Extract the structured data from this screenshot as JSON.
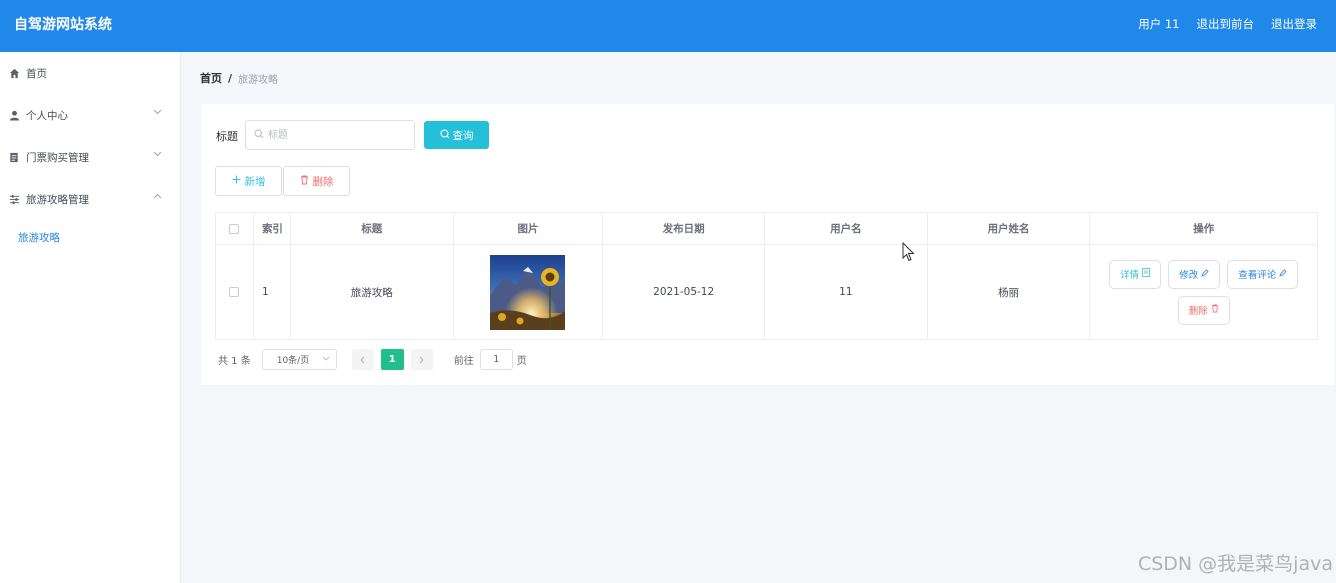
{
  "app": {
    "title": "自驾游网站系统"
  },
  "header": {
    "user_label": "用户 11",
    "front_label": "退出到前台",
    "logout_label": "退出登录"
  },
  "sidebar": {
    "items": [
      {
        "label": "首页",
        "icon": "home-icon"
      },
      {
        "label": "个人中心",
        "icon": "user-icon"
      },
      {
        "label": "门票购买管理",
        "icon": "document-icon"
      },
      {
        "label": "旅游攻略管理",
        "icon": "sliders-icon"
      }
    ],
    "sub_items": [
      {
        "label": "旅游攻略"
      }
    ]
  },
  "breadcrumb": {
    "home": "首页",
    "separator": "/",
    "current": "旅游攻略"
  },
  "search": {
    "label": "标题",
    "placeholder": "标题",
    "value": "",
    "button_label": "查询"
  },
  "toolbar": {
    "add_label": "新增",
    "delete_label": "删除"
  },
  "table": {
    "headers": [
      "索引",
      "标题",
      "图片",
      "发布日期",
      "用户名",
      "用户姓名",
      "操作"
    ],
    "rows": [
      {
        "index": "1",
        "title": "旅游攻略",
        "image": "sunflower-landscape-thumbnail",
        "date": "2021-05-12",
        "username": "11",
        "name": "杨丽",
        "actions": {
          "detail": "详情",
          "edit": "修改",
          "comments": "查看评论",
          "delete": "删除"
        }
      }
    ]
  },
  "pagination": {
    "total": "共 1 条",
    "page_size": "10条/页",
    "current_page": "1",
    "goto_label": "前往",
    "goto_value": "1",
    "page_unit": "页"
  },
  "watermark": "CSDN @我是菜鸟java",
  "colors": {
    "header_bg": "#2088e8",
    "accent_cyan": "#23c0d8",
    "danger": "#f26b6b",
    "page_active": "#1fbe8a",
    "link_blue": "#2b86e0"
  }
}
